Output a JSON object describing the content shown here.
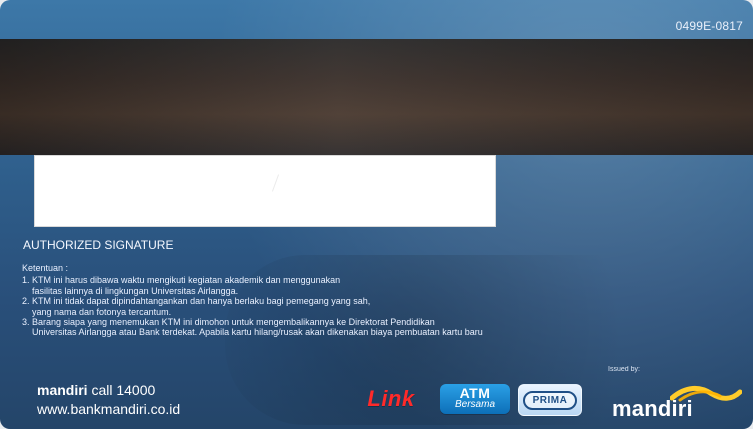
{
  "card": {
    "serial": "0499E-0817",
    "authorized_signature_label": "AUTHORIZED SIGNATURE",
    "terms": {
      "heading": "Ketentuan :",
      "lines": [
        "1. KTM ini harus dibawa waktu mengikuti kegiatan akademik dan menggunakan",
        "fasilitas lainnya di lingkungan Universitas Airlangga.",
        "2. KTM ini tidak dapat dipindahtangankan dan hanya berlaku bagi pemegang yang sah,",
        "yang nama dan fotonya tercantum.",
        "3. Barang siapa yang menemukan KTM ini dimohon untuk mengembalikannya ke Direktorat Pendidikan",
        "Universitas Airlangga atau Bank terdekat. Apabila kartu hilang/rusak akan dikenakan biaya pembuatan kartu baru"
      ]
    },
    "issued_by": "Issued by:",
    "bank": {
      "call_brand": "mandiri",
      "call_text": " call 14000",
      "website": "www.bankmandiri.co.id",
      "logo_text": "mandiri"
    },
    "network_logos": {
      "link": "Link",
      "atm_top": "ATM",
      "atm_bottom": "Bersama",
      "prima": "PRIMA"
    }
  }
}
